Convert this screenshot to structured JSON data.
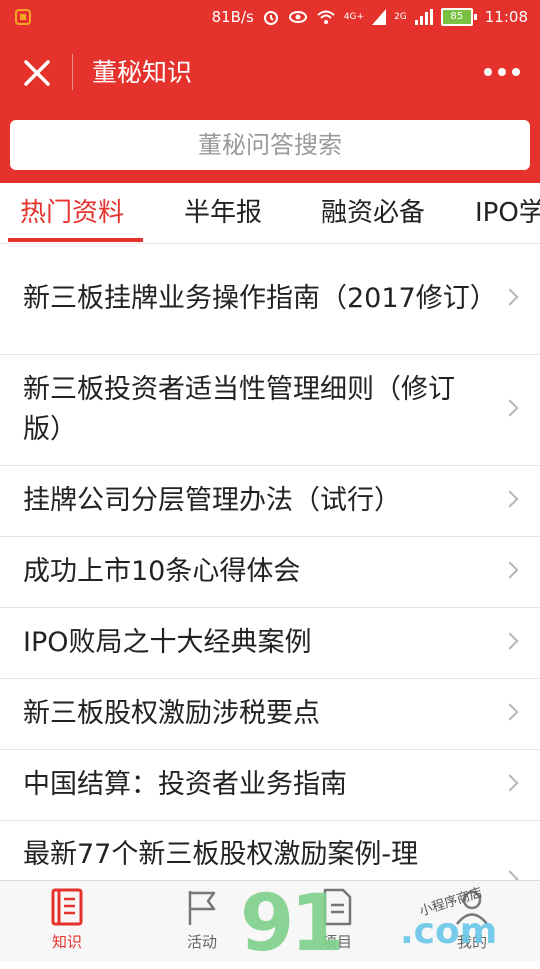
{
  "status_bar": {
    "network_speed": "81B/s",
    "signal_labels": [
      "4G+",
      "2G",
      "2G"
    ],
    "battery": "85",
    "time": "11:08",
    "icons": [
      "alarm-icon",
      "eye-icon",
      "wifi-icon",
      "signal-icon",
      "battery-icon"
    ]
  },
  "nav": {
    "title": "董秘知识"
  },
  "search": {
    "placeholder": "董秘问答搜索"
  },
  "tabs": [
    {
      "label": "热门资料",
      "active": true
    },
    {
      "label": "半年报"
    },
    {
      "label": "融资必备"
    },
    {
      "label": "IPO学"
    }
  ],
  "list": [
    {
      "title": "新三板挂牌业务操作指南（2017修订）"
    },
    {
      "title": "新三板投资者适当性管理细则（修订版）"
    },
    {
      "title": "挂牌公司分层管理办法（试行）"
    },
    {
      "title": "成功上市10条心得体会"
    },
    {
      "title": "IPO败局之十大经典案例"
    },
    {
      "title": "新三板股权激励涉税要点"
    },
    {
      "title": "中国结算：投资者业务指南"
    },
    {
      "title": "最新77个新三板股权激励案例-理"
    }
  ],
  "bottom_nav": [
    {
      "label": "知识",
      "icon": "book-icon",
      "active": true
    },
    {
      "label": "活动",
      "icon": "flag-icon"
    },
    {
      "label": "项目",
      "icon": "document-icon"
    },
    {
      "label": "我的",
      "icon": "user-icon"
    }
  ],
  "watermark": {
    "main": "91",
    "suffix": ".com",
    "small": "小程序商店"
  },
  "colors": {
    "brand_red": "#e5322d",
    "text": "#222222",
    "muted": "#9a9a9a"
  }
}
